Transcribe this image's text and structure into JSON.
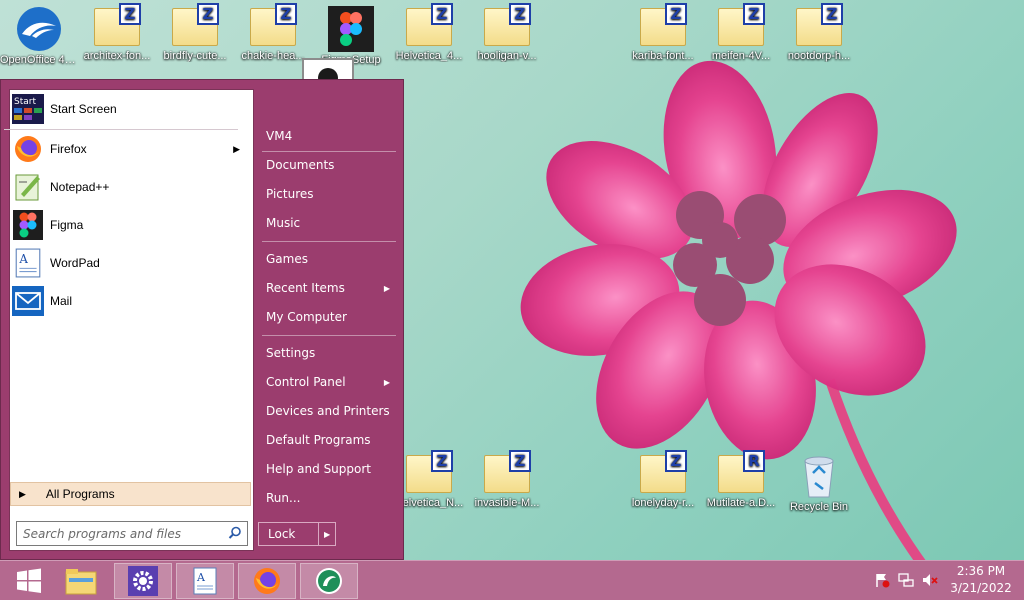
{
  "desktop": {
    "icons_top": [
      {
        "label": "OpenOffice 4.1.13",
        "kind": "openoffice"
      },
      {
        "label": "architex-fon...",
        "kind": "folder",
        "badge": "Z"
      },
      {
        "label": "birdfly-cute...",
        "kind": "folder",
        "badge": "Z"
      },
      {
        "label": "chakie-hea...",
        "kind": "folder",
        "badge": "Z"
      },
      {
        "label": "FigmaSetup",
        "kind": "figma"
      },
      {
        "label": "Helvetica_4...",
        "kind": "folder",
        "badge": "Z"
      },
      {
        "label": "hooligan-v...",
        "kind": "folder",
        "badge": "Z"
      },
      {
        "label": "kariba-font...",
        "kind": "folder",
        "badge": "Z"
      },
      {
        "label": "meifen-4V...",
        "kind": "folder",
        "badge": "Z"
      },
      {
        "label": "nootdorp-h...",
        "kind": "folder",
        "badge": "Z"
      }
    ],
    "icons_bottom": [
      {
        "label": "Helvetica_N...",
        "kind": "folder",
        "badge": "Z"
      },
      {
        "label": "invasible-M...",
        "kind": "folder",
        "badge": "Z"
      },
      {
        "label": "lonelyday-r...",
        "kind": "folder",
        "badge": "Z"
      },
      {
        "label": "Mutilate-a.D...",
        "kind": "folder",
        "badge": "R"
      },
      {
        "label": "Recycle Bin",
        "kind": "recycle"
      }
    ]
  },
  "start_menu": {
    "programs": [
      {
        "label": "Start Screen",
        "icon": "start-screen-icon",
        "arrow": ""
      },
      {
        "label": "Firefox",
        "icon": "firefox-icon",
        "arrow": "▶"
      },
      {
        "label": "Notepad++",
        "icon": "notepadpp-icon",
        "arrow": ""
      },
      {
        "label": "Figma",
        "icon": "figma-icon",
        "arrow": ""
      },
      {
        "label": "WordPad",
        "icon": "wordpad-icon",
        "arrow": ""
      },
      {
        "label": "Mail",
        "icon": "mail-icon",
        "arrow": ""
      }
    ],
    "start_screen_icon_text": "Start",
    "all_programs": "All Programs",
    "search_placeholder": "Search programs and files",
    "right_items": [
      {
        "label": "VM4",
        "arrow": ""
      },
      {
        "label": "Documents",
        "arrow": ""
      },
      {
        "label": "Pictures",
        "arrow": ""
      },
      {
        "label": "Music",
        "arrow": ""
      },
      {
        "label": "Games",
        "arrow": ""
      },
      {
        "label": "Recent Items",
        "arrow": "▶"
      },
      {
        "label": "My Computer",
        "arrow": ""
      },
      {
        "label": "Settings",
        "arrow": ""
      },
      {
        "label": "Control Panel",
        "arrow": "▶"
      },
      {
        "label": "Devices and Printers",
        "arrow": ""
      },
      {
        "label": "Default Programs",
        "arrow": ""
      },
      {
        "label": "Help and Support",
        "arrow": ""
      },
      {
        "label": "Run...",
        "arrow": ""
      }
    ],
    "lock_label": "Lock",
    "lock_arrow": "▶"
  },
  "taskbar": {
    "buttons": [
      "start-button",
      "file-explorer-icon",
      "settings-icon",
      "wordpad-icon",
      "firefox-icon",
      "app-icon"
    ],
    "clock_time": "2:36 PM",
    "clock_date": "3/21/2022"
  },
  "colors": {
    "menu_bg": "#9b3d6e",
    "taskbar_bg": "#b4698f",
    "folder_badge": "#1e3fa8"
  }
}
